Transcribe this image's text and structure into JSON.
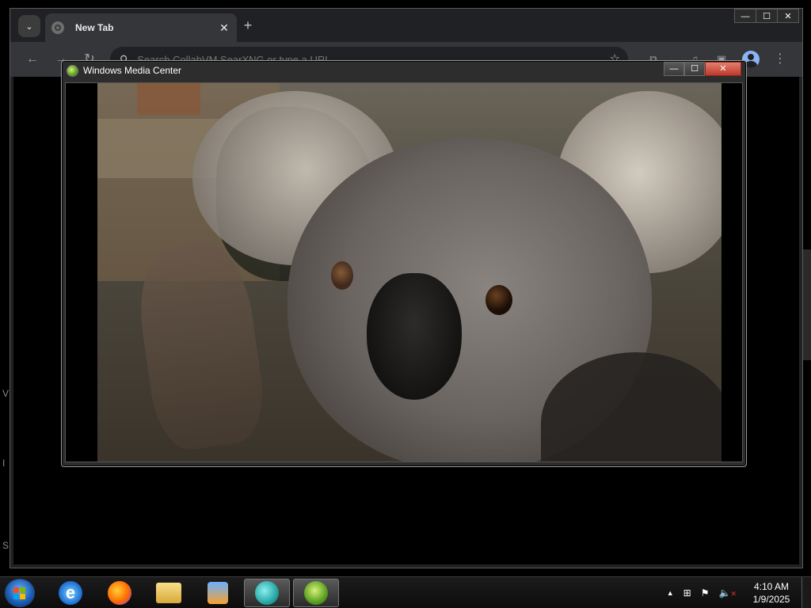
{
  "browser": {
    "tab_title": "New Tab",
    "tab_close": "✕",
    "new_tab": "+",
    "omnibox_placeholder": "Search CollabVM SearXNG or type a URL",
    "window_controls": {
      "minimize": "—",
      "maximize": "☐",
      "close": "✕"
    },
    "nav": {
      "back": "←",
      "forward": "→",
      "reload": "↻"
    },
    "toolbar_icons": [
      "extensions-icon",
      "media-icon",
      "sidebar-icon",
      "profile-icon",
      "menu-icon"
    ]
  },
  "desktop": {
    "left_fragments": [
      "V",
      "I",
      "S"
    ]
  },
  "wmc": {
    "title": "Windows Media Center",
    "controls": {
      "minimize": "—",
      "maximize": "☐",
      "close": "✕"
    }
  },
  "taskbar": {
    "pinned": [
      "internet-explorer-icon",
      "firefox-icon",
      "file-explorer-icon",
      "media-player-icon",
      "virtualbox-icon",
      "media-center-icon"
    ],
    "tray": {
      "arrow": "▲",
      "time": "4:10 AM",
      "date": "1/9/2025"
    }
  }
}
